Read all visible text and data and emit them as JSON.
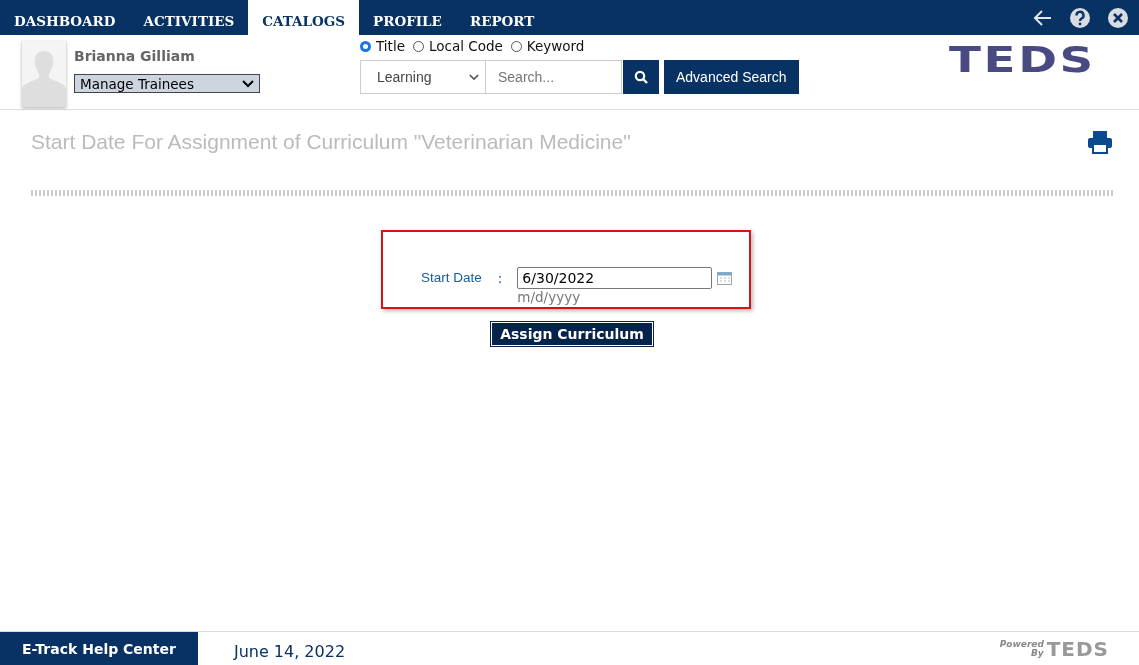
{
  "nav": {
    "tabs": [
      {
        "label": "DASHBOARD",
        "selected": false
      },
      {
        "label": "ACTIVITIES",
        "selected": false
      },
      {
        "label": "CATALOGS",
        "selected": true
      },
      {
        "label": "PROFILE",
        "selected": false
      },
      {
        "label": "REPORT",
        "selected": false
      }
    ]
  },
  "user": {
    "name": "Brianna Gilliam",
    "role": "Manage Trainees"
  },
  "search": {
    "modes": [
      {
        "label": "Title",
        "selected": true
      },
      {
        "label": "Local Code",
        "selected": false
      },
      {
        "label": "Keyword",
        "selected": false
      }
    ],
    "category": "Learning",
    "placeholder": "Search...",
    "advanced": "Advanced Search"
  },
  "logo": "TEDS",
  "page_title": "Start Date For Assignment of Curriculum \"Veterinarian Medicine\"",
  "form": {
    "label": "Start Date",
    "separator": ":",
    "value": "6/30/2022",
    "hint": "m/d/yyyy",
    "button": "Assign Curriculum"
  },
  "footer": {
    "help": "E-Track Help Center",
    "date": "June 14, 2022",
    "powered": "Powered By",
    "brand": "TEDS"
  }
}
